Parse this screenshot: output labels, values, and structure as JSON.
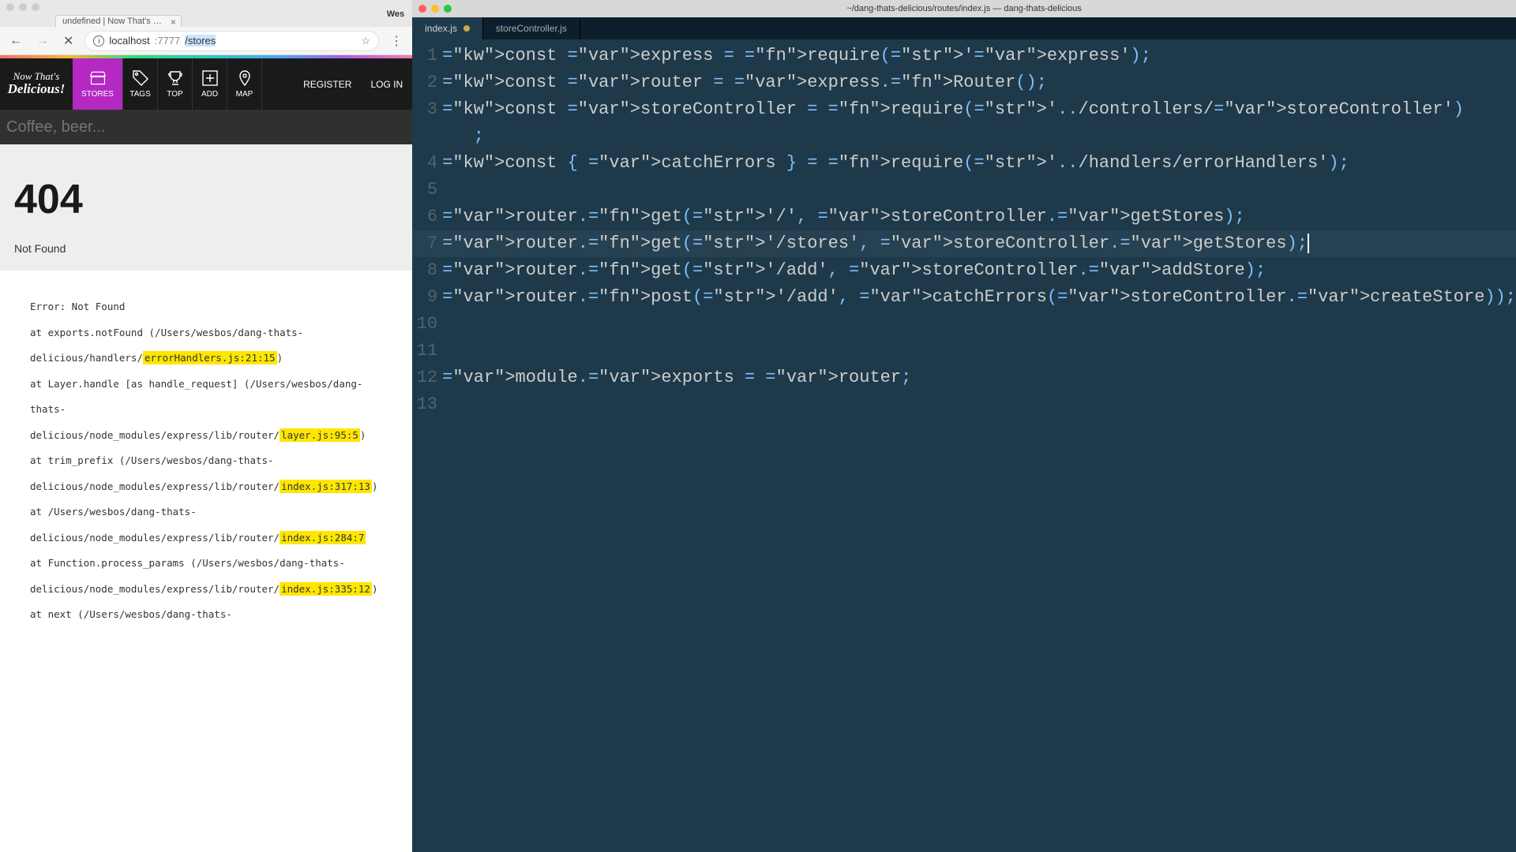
{
  "browser": {
    "tab_title": "undefined | Now That's Delicio",
    "menu_label": "Wes",
    "url_display_prefix": "localhost",
    "url_display_port": ":7777",
    "url_display_path": "/stores"
  },
  "site": {
    "logo_line1": "Now That's",
    "logo_line2": "Delicious!",
    "nav": [
      {
        "key": "stores",
        "label": "STORES",
        "icon": "store"
      },
      {
        "key": "tags",
        "label": "TAGS",
        "icon": "tag"
      },
      {
        "key": "top",
        "label": "TOP",
        "icon": "trophy"
      },
      {
        "key": "add",
        "label": "ADD",
        "icon": "plus"
      },
      {
        "key": "map",
        "label": "MAP",
        "icon": "pin"
      }
    ],
    "register": "REGISTER",
    "login": "LOG IN",
    "search_placeholder": "Coffee, beer..."
  },
  "page": {
    "heading": "404",
    "subheading": "Not Found",
    "stack": [
      {
        "pre": "Error: Not Found",
        "hl": "",
        "post": ""
      },
      {
        "pre": "at exports.notFound (/Users/wesbos/dang-thats-delicious/handlers/",
        "hl": "errorHandlers.js:21:15",
        "post": ")"
      },
      {
        "pre": "at Layer.handle [as handle_request] (/Users/wesbos/dang-thats-delicious/node_modules/express/lib/router/",
        "hl": "layer.js:95:5",
        "post": ")"
      },
      {
        "pre": "at trim_prefix (/Users/wesbos/dang-thats-delicious/node_modules/express/lib/router/",
        "hl": "index.js:317:13",
        "post": ")"
      },
      {
        "pre": "at /Users/wesbos/dang-thats-delicious/node_modules/express/lib/router/",
        "hl": "index.js:284:7",
        "post": ""
      },
      {
        "pre": "at Function.process_params (/Users/wesbos/dang-thats-delicious/node_modules/express/lib/router/",
        "hl": "index.js:335:12",
        "post": ")"
      },
      {
        "pre": "at next (/Users/wesbos/dang-thats-",
        "hl": "",
        "post": ""
      }
    ]
  },
  "editor": {
    "title": "~/dang-thats-delicious/routes/index.js — dang-thats-delicious",
    "tabs": [
      {
        "name": "index.js",
        "dirty": true,
        "active": true
      },
      {
        "name": "storeController.js",
        "dirty": false,
        "active": false
      }
    ],
    "code": {
      "1": "const express = require('express');",
      "2": "const router = express.Router();",
      "3": "const storeController = require('../controllers/storeController');",
      "4": "const { catchErrors } = require('../handlers/errorHandlers');",
      "5": "",
      "6": "router.get('/', storeController.getStores);",
      "7": "router.get('/stores', storeController.getStores);",
      "8": "router.get('/add', storeController.addStore);",
      "9": "router.post('/add', catchErrors(storeController.createStore));",
      "10": "",
      "11": "",
      "12": "module.exports = router;",
      "13": ""
    }
  }
}
